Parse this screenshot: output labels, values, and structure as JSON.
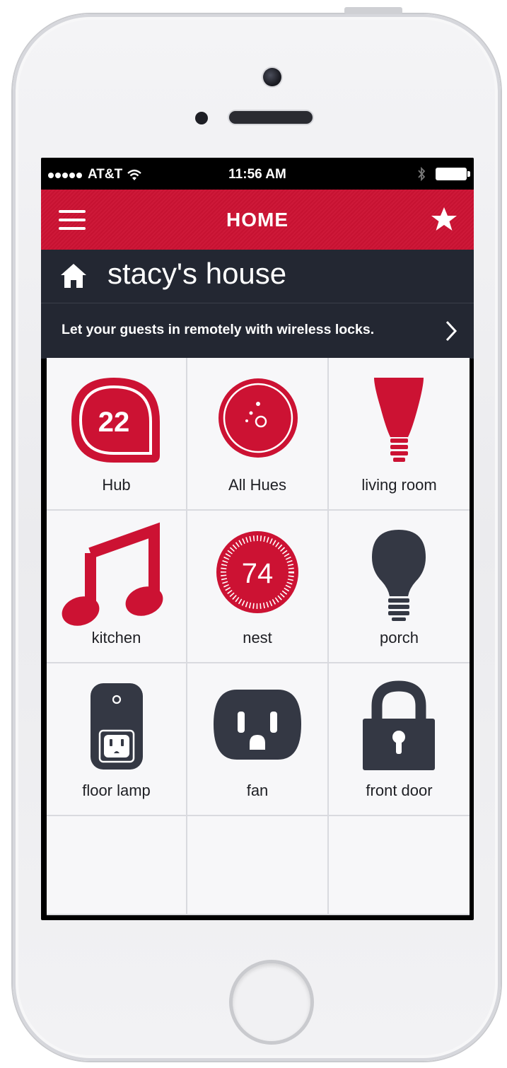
{
  "status_bar": {
    "carrier": "AT&T",
    "time": "11:56 AM"
  },
  "nav": {
    "title": "HOME",
    "menu_icon": "hamburger-menu-icon",
    "favorite_icon": "star-icon"
  },
  "location": {
    "name": "stacy's house",
    "icon": "house-icon"
  },
  "promo": {
    "text": "Let your guests in remotely with wireless locks."
  },
  "colors": {
    "accent": "#cc1233",
    "dark": "#232732",
    "tile_bg": "#f7f7f9"
  },
  "tiles": [
    {
      "label": "Hub",
      "icon": "hub-icon",
      "badge": "22"
    },
    {
      "label": "All Hues",
      "icon": "hue-bridge-icon"
    },
    {
      "label": "living room",
      "icon": "hue-bulb-icon"
    },
    {
      "label": "kitchen",
      "icon": "music-note-icon"
    },
    {
      "label": "nest",
      "icon": "nest-thermostat-icon",
      "badge": "74"
    },
    {
      "label": "porch",
      "icon": "light-bulb-icon"
    },
    {
      "label": "floor lamp",
      "icon": "smart-plug-icon"
    },
    {
      "label": "fan",
      "icon": "outlet-icon"
    },
    {
      "label": "front door",
      "icon": "padlock-icon"
    }
  ]
}
